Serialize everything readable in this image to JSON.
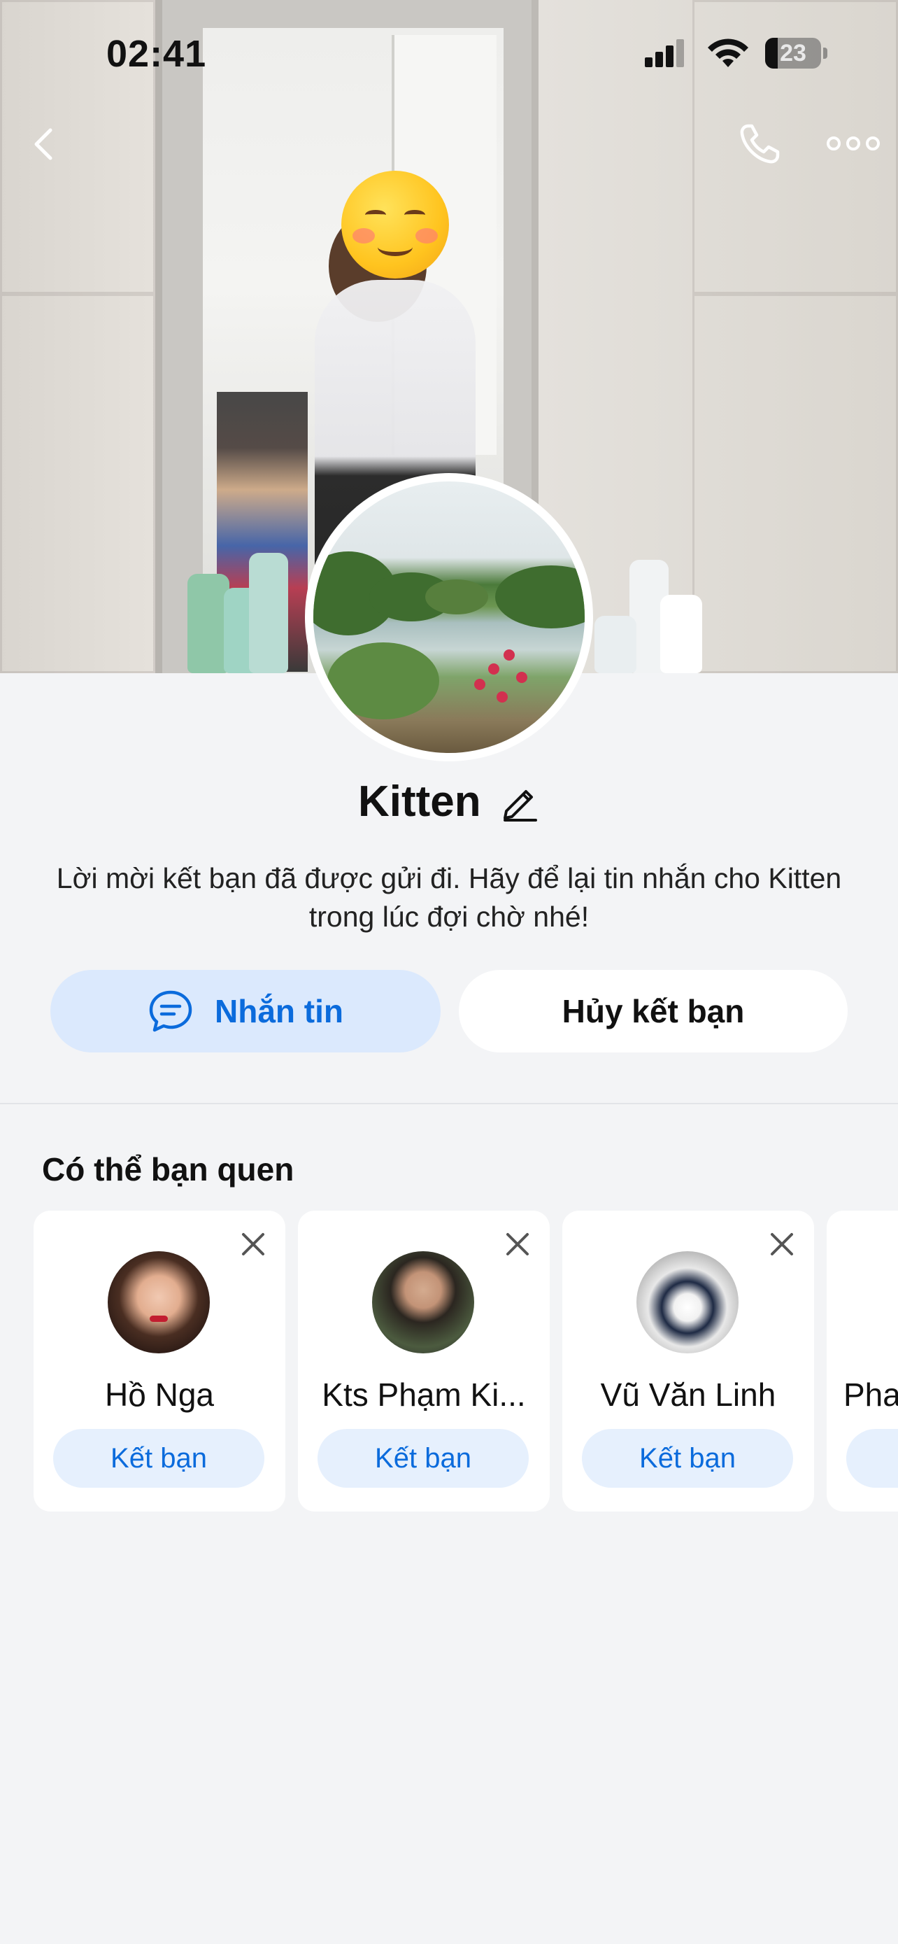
{
  "status_bar": {
    "time": "02:41",
    "battery_percent": 23,
    "battery_label": "23",
    "signal_bars": 3,
    "icons": [
      "signal-icon",
      "wifi-icon",
      "battery-icon"
    ]
  },
  "nav": {
    "back_icon": "chevron-left-icon",
    "call_icon": "phone-icon",
    "more_icon": "more-dots-icon"
  },
  "profile": {
    "name": "Kitten",
    "edit_icon": "pencil-icon",
    "description": "Lời mời kết bạn đã được gửi đi. Hãy để lại tin nhắn cho Kitten trong lúc đợi chờ nhé!"
  },
  "actions": {
    "message_label": "Nhắn tin",
    "message_icon": "chat-bubble-icon",
    "cancel_label": "Hủy kết bạn"
  },
  "suggestions": {
    "title": "Có thể bạn quen",
    "add_label": "Kết bạn",
    "items": [
      {
        "name": "Hồ Nga"
      },
      {
        "name": "Kts Phạm Ki..."
      },
      {
        "name": "Vũ Văn Linh"
      },
      {
        "name": "Pha"
      }
    ]
  },
  "colors": {
    "accent": "#0b6bdc",
    "accent_soft": "#dbe9fd",
    "background": "#f3f4f6",
    "card": "#ffffff"
  }
}
